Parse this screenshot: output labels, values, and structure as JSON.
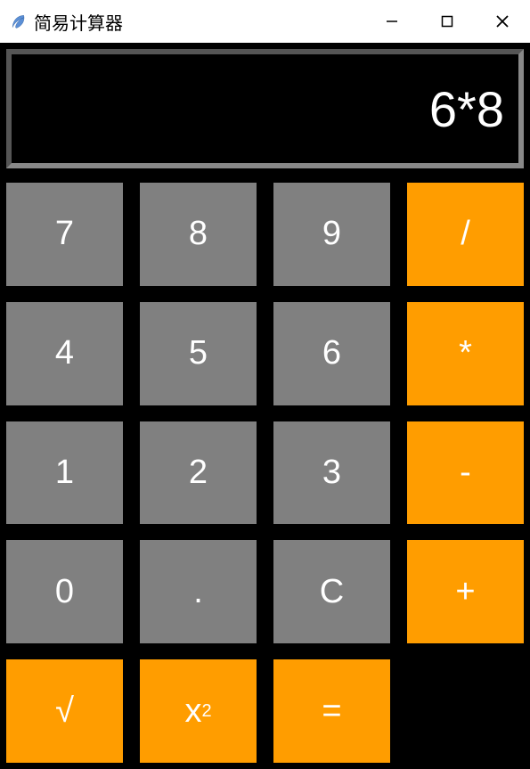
{
  "window": {
    "title": "简易计算器",
    "minimize": "—",
    "maximize": "☐",
    "close": "✕"
  },
  "display": {
    "value": "6*8"
  },
  "buttons": {
    "r0c0": "7",
    "r0c1": "8",
    "r0c2": "9",
    "r0c3": "/",
    "r1c0": "4",
    "r1c1": "5",
    "r1c2": "6",
    "r1c3": "*",
    "r2c0": "1",
    "r2c1": "2",
    "r2c2": "3",
    "r2c3": "-",
    "r3c0": "0",
    "r3c1": ".",
    "r3c2": "C",
    "r3c3": "+",
    "r4c0": "√",
    "r4c1": "x²",
    "r4c2": "="
  }
}
